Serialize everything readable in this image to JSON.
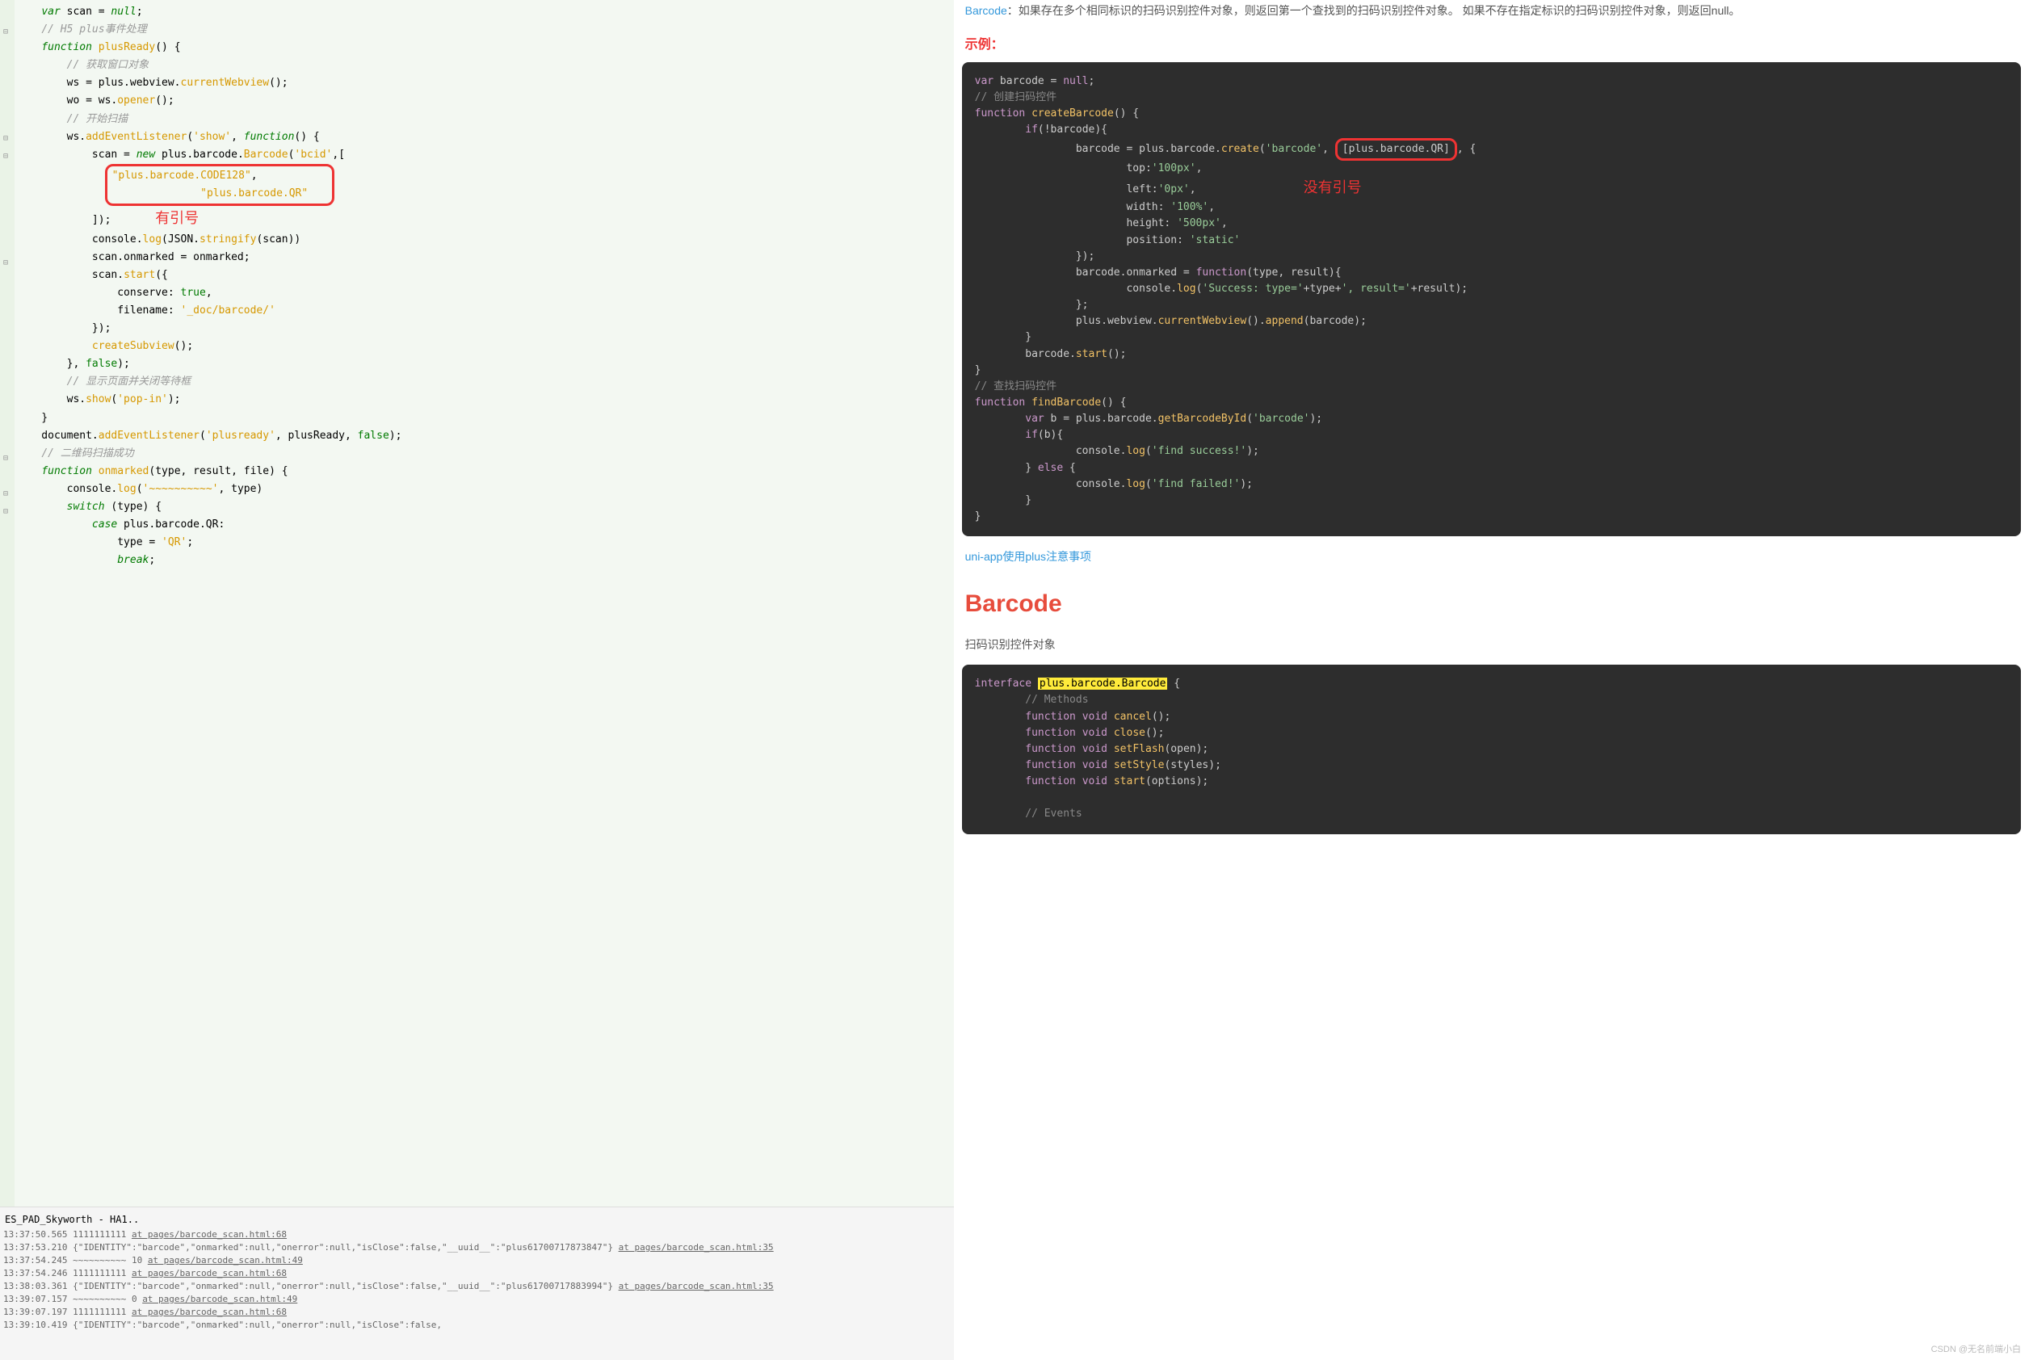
{
  "editor": {
    "code_html": "    <span class='kw'>var</span> scan = <span class='kw'>null</span>;\n    <span class='com'>// H5 plus事件处理</span>\n    <span class='kw'>function</span> <span class='fn'>plusReady</span>() {\n        <span class='com'>// 获取窗口对象</span>\n        ws = plus.webview.<span class='fn'>currentWebview</span>();\n        wo = ws.<span class='fn'>opener</span>();\n        <span class='com'>// 开始扫描</span>\n        ws.<span class='fn'>addEventListener</span>(<span class='str'>'show'</span>, <span class='kw'>function</span>() {\n            scan = <span class='kw'>new</span> plus.barcode.<span class='fn'>Barcode</span>(<span class='str'>'bcid'</span>,[\n              <span class='highlight-box'><span class='str'>\"plus.barcode.CODE128\"</span>,\n              <span class='str'>\"plus.barcode.QR\"</span>   </span>\n            ]);       <span class='annotation'>有引号</span>\n            console.<span class='fn'>log</span>(JSON.<span class='fn'>stringify</span>(scan))\n            scan.onmarked = onmarked;\n            scan.<span class='fn'>start</span>({\n                conserve: <span class='bool'>true</span>,\n                filename: <span class='str'>'_doc/barcode/'</span>\n            });\n            <span class='fn'>createSubview</span>();\n        }, <span class='bool'>false</span>);\n        <span class='com'>// 显示页面并关闭等待框</span>\n        ws.<span class='fn'>show</span>(<span class='str'>'pop-in'</span>);\n    }\n    document.<span class='fn'>addEventListener</span>(<span class='str'>'plusready'</span>, plusReady, <span class='bool'>false</span>);\n    <span class='com'>// 二维码扫描成功</span>\n    <span class='kw'>function</span> <span class='fn'>onmarked</span>(type, result, file) {\n        console.<span class='fn'>log</span>(<span class='str'>'~~~~~~~~~~'</span>, type)\n        <span class='kw'>switch</span> (type) {\n            <span class='kw'>case</span> plus.barcode.QR:\n                type = <span class='str'>'QR'</span>;\n                <span class='kw'>break</span>;"
  },
  "console": {
    "title": "ES_PAD_Skyworth - HA1..",
    "lines": [
      {
        "ts": "13:37:50.565",
        "body": "1111111111 ",
        "link": "at pages/barcode_scan.html:68"
      },
      {
        "ts": "13:37:53.210",
        "body": "{\"IDENTITY\":\"barcode\",\"onmarked\":null,\"onerror\":null,\"isClose\":false,\"__uuid__\":\"plus61700717873847\"} ",
        "link": "at pages/barcode_scan.html:35"
      },
      {
        "ts": "13:37:54.245",
        "body": "~~~~~~~~~~ 10 ",
        "link": "at pages/barcode_scan.html:49"
      },
      {
        "ts": "13:37:54.246",
        "body": "1111111111 ",
        "link": "at pages/barcode_scan.html:68"
      },
      {
        "ts": "13:38:03.361",
        "body": "{\"IDENTITY\":\"barcode\",\"onmarked\":null,\"onerror\":null,\"isClose\":false,\"__uuid__\":\"plus61700717883994\"} ",
        "link": "at pages/barcode_scan.html:35"
      },
      {
        "ts": "13:39:07.157",
        "body": "~~~~~~~~~~ 0 ",
        "link": "at pages/barcode_scan.html:49"
      },
      {
        "ts": "13:39:07.197",
        "body": "1111111111 ",
        "link": "at pages/barcode_scan.html:68"
      },
      {
        "ts": "13:39:10.419",
        "body": "{\"IDENTITY\":\"barcode\",\"onmarked\":null,\"onerror\":null,\"isClose\":false,",
        "link": ""
      }
    ]
  },
  "doc": {
    "intro_link": "Barcode",
    "intro_text": "：如果存在多个相同标识的扫码识别控件对象，则返回第一个查找到的扫码识别控件对象。 如果不存在指定标识的扫码识别控件对象，则返回null。",
    "example_heading": "示例：",
    "code1_html": "<span class='d-kw'>var</span> barcode = <span class='d-kw'>null</span>;\n<span class='d-com'>// 创建扫码控件</span>\n<span class='d-kw'>function</span> <span class='d-fn'>createBarcode</span>() {\n        <span class='d-kw'>if</span>(!barcode){\n                barcode = plus.barcode.<span class='d-fn'>create</span>(<span class='d-str'>'barcode'</span>, <span class='highlight-box'>[plus.barcode.QR]</span>, {\n                        top:<span class='d-str'>'100px'</span>,\n                        left:<span class='d-str'>'0px'</span>,                 <span class='annotation'>没有引号</span>\n                        width: <span class='d-str'>'100%'</span>,\n                        height: <span class='d-str'>'500px'</span>,\n                        position: <span class='d-str'>'static'</span>\n                });\n                barcode.onmarked = <span class='d-kw'>function</span>(type, result){\n                        console.<span class='d-fn'>log</span>(<span class='d-str'>'Success: type='</span>+type+<span class='d-str'>', result='</span>+result);\n                };\n                plus.webview.<span class='d-fn'>currentWebview</span>().<span class='d-fn'>append</span>(barcode);\n        }\n        barcode.<span class='d-fn'>start</span>();\n}\n<span class='d-com'>// 查找扫码控件</span>\n<span class='d-kw'>function</span> <span class='d-fn'>findBarcode</span>() {\n        <span class='d-kw'>var</span> b = plus.barcode.<span class='d-fn'>getBarcodeById</span>(<span class='d-str'>'barcode'</span>);\n        <span class='d-kw'>if</span>(b){\n                console.<span class='d-fn'>log</span>(<span class='d-str'>'find success!'</span>);\n        } <span class='d-kw'>else</span> {\n                console.<span class='d-fn'>log</span>(<span class='d-str'>'find failed!'</span>);\n        }\n}",
    "link_uniapp": "uni-app使用plus注意事项",
    "h1": "Barcode",
    "desc": "扫码识别控件对象",
    "code2_html": "<span class='d-kw'>interface</span> <span class='d-hl'>plus.barcode.Barcode</span> {\n        <span class='d-com'>// Methods</span>\n        <span class='d-kw'>function</span> <span class='d-kw'>void</span> <span class='d-fn'>cancel</span>();\n        <span class='d-kw'>function</span> <span class='d-kw'>void</span> <span class='d-fn'>close</span>();\n        <span class='d-kw'>function</span> <span class='d-kw'>void</span> <span class='d-fn'>setFlash</span>(open);\n        <span class='d-kw'>function</span> <span class='d-kw'>void</span> <span class='d-fn'>setStyle</span>(styles);\n        <span class='d-kw'>function</span> <span class='d-kw'>void</span> <span class='d-fn'>start</span>(options);\n\n        <span class='d-com'>// Events</span>"
  },
  "watermark": "CSDN @无名前端小白"
}
